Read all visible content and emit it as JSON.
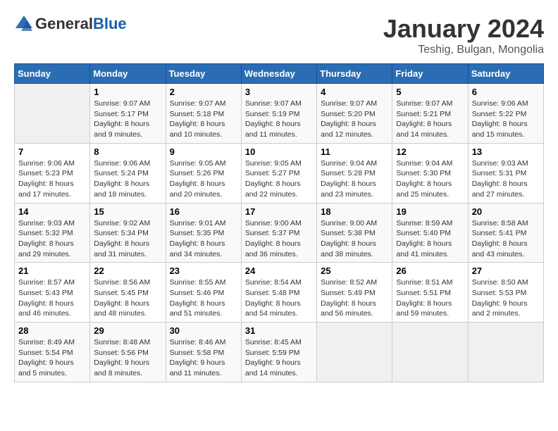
{
  "header": {
    "logo_general": "General",
    "logo_blue": "Blue",
    "month_title": "January 2024",
    "location": "Teshig, Bulgan, Mongolia"
  },
  "calendar": {
    "days_of_week": [
      "Sunday",
      "Monday",
      "Tuesday",
      "Wednesday",
      "Thursday",
      "Friday",
      "Saturday"
    ],
    "weeks": [
      [
        {
          "day": "",
          "info": ""
        },
        {
          "day": "1",
          "info": "Sunrise: 9:07 AM\nSunset: 5:17 PM\nDaylight: 8 hours\nand 9 minutes."
        },
        {
          "day": "2",
          "info": "Sunrise: 9:07 AM\nSunset: 5:18 PM\nDaylight: 8 hours\nand 10 minutes."
        },
        {
          "day": "3",
          "info": "Sunrise: 9:07 AM\nSunset: 5:19 PM\nDaylight: 8 hours\nand 11 minutes."
        },
        {
          "day": "4",
          "info": "Sunrise: 9:07 AM\nSunset: 5:20 PM\nDaylight: 8 hours\nand 12 minutes."
        },
        {
          "day": "5",
          "info": "Sunrise: 9:07 AM\nSunset: 5:21 PM\nDaylight: 8 hours\nand 14 minutes."
        },
        {
          "day": "6",
          "info": "Sunrise: 9:06 AM\nSunset: 5:22 PM\nDaylight: 8 hours\nand 15 minutes."
        }
      ],
      [
        {
          "day": "7",
          "info": "Sunrise: 9:06 AM\nSunset: 5:23 PM\nDaylight: 8 hours\nand 17 minutes."
        },
        {
          "day": "8",
          "info": "Sunrise: 9:06 AM\nSunset: 5:24 PM\nDaylight: 8 hours\nand 18 minutes."
        },
        {
          "day": "9",
          "info": "Sunrise: 9:05 AM\nSunset: 5:26 PM\nDaylight: 8 hours\nand 20 minutes."
        },
        {
          "day": "10",
          "info": "Sunrise: 9:05 AM\nSunset: 5:27 PM\nDaylight: 8 hours\nand 22 minutes."
        },
        {
          "day": "11",
          "info": "Sunrise: 9:04 AM\nSunset: 5:28 PM\nDaylight: 8 hours\nand 23 minutes."
        },
        {
          "day": "12",
          "info": "Sunrise: 9:04 AM\nSunset: 5:30 PM\nDaylight: 8 hours\nand 25 minutes."
        },
        {
          "day": "13",
          "info": "Sunrise: 9:03 AM\nSunset: 5:31 PM\nDaylight: 8 hours\nand 27 minutes."
        }
      ],
      [
        {
          "day": "14",
          "info": "Sunrise: 9:03 AM\nSunset: 5:32 PM\nDaylight: 8 hours\nand 29 minutes."
        },
        {
          "day": "15",
          "info": "Sunrise: 9:02 AM\nSunset: 5:34 PM\nDaylight: 8 hours\nand 31 minutes."
        },
        {
          "day": "16",
          "info": "Sunrise: 9:01 AM\nSunset: 5:35 PM\nDaylight: 8 hours\nand 34 minutes."
        },
        {
          "day": "17",
          "info": "Sunrise: 9:00 AM\nSunset: 5:37 PM\nDaylight: 8 hours\nand 36 minutes."
        },
        {
          "day": "18",
          "info": "Sunrise: 9:00 AM\nSunset: 5:38 PM\nDaylight: 8 hours\nand 38 minutes."
        },
        {
          "day": "19",
          "info": "Sunrise: 8:59 AM\nSunset: 5:40 PM\nDaylight: 8 hours\nand 41 minutes."
        },
        {
          "day": "20",
          "info": "Sunrise: 8:58 AM\nSunset: 5:41 PM\nDaylight: 8 hours\nand 43 minutes."
        }
      ],
      [
        {
          "day": "21",
          "info": "Sunrise: 8:57 AM\nSunset: 5:43 PM\nDaylight: 8 hours\nand 46 minutes."
        },
        {
          "day": "22",
          "info": "Sunrise: 8:56 AM\nSunset: 5:45 PM\nDaylight: 8 hours\nand 48 minutes."
        },
        {
          "day": "23",
          "info": "Sunrise: 8:55 AM\nSunset: 5:46 PM\nDaylight: 8 hours\nand 51 minutes."
        },
        {
          "day": "24",
          "info": "Sunrise: 8:54 AM\nSunset: 5:48 PM\nDaylight: 8 hours\nand 54 minutes."
        },
        {
          "day": "25",
          "info": "Sunrise: 8:52 AM\nSunset: 5:49 PM\nDaylight: 8 hours\nand 56 minutes."
        },
        {
          "day": "26",
          "info": "Sunrise: 8:51 AM\nSunset: 5:51 PM\nDaylight: 8 hours\nand 59 minutes."
        },
        {
          "day": "27",
          "info": "Sunrise: 8:50 AM\nSunset: 5:53 PM\nDaylight: 9 hours\nand 2 minutes."
        }
      ],
      [
        {
          "day": "28",
          "info": "Sunrise: 8:49 AM\nSunset: 5:54 PM\nDaylight: 9 hours\nand 5 minutes."
        },
        {
          "day": "29",
          "info": "Sunrise: 8:48 AM\nSunset: 5:56 PM\nDaylight: 9 hours\nand 8 minutes."
        },
        {
          "day": "30",
          "info": "Sunrise: 8:46 AM\nSunset: 5:58 PM\nDaylight: 9 hours\nand 11 minutes."
        },
        {
          "day": "31",
          "info": "Sunrise: 8:45 AM\nSunset: 5:59 PM\nDaylight: 9 hours\nand 14 minutes."
        },
        {
          "day": "",
          "info": ""
        },
        {
          "day": "",
          "info": ""
        },
        {
          "day": "",
          "info": ""
        }
      ]
    ]
  }
}
